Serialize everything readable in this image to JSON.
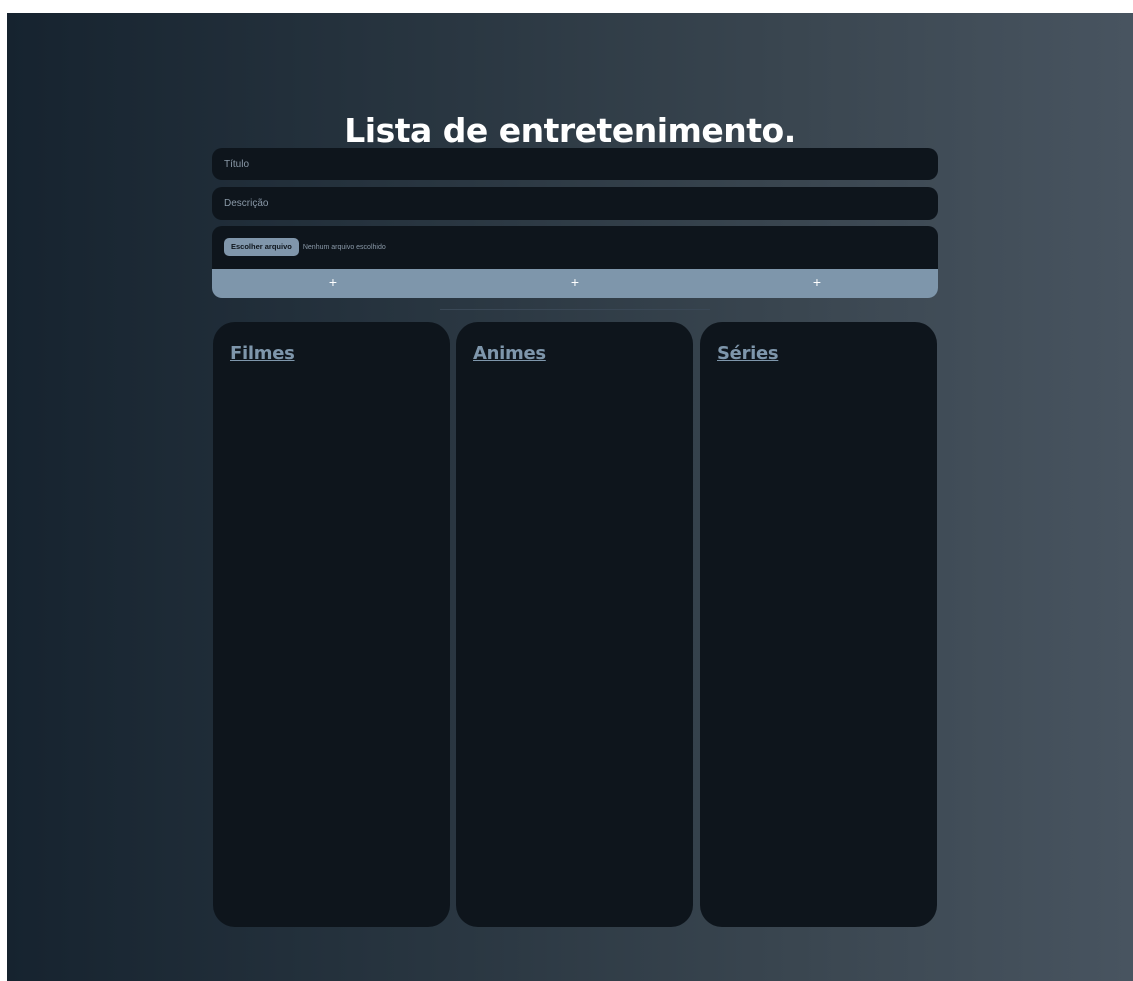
{
  "header": {
    "title": "Lista de entretenimento."
  },
  "form": {
    "title_placeholder": "Título",
    "description_placeholder": "Descrição",
    "file_button_label": "Escolher arquivo",
    "file_status": "Nenhum arquivo escolhido",
    "add_buttons": [
      "+",
      "+",
      "+"
    ]
  },
  "columns": [
    {
      "heading": "Filmes"
    },
    {
      "heading": "Animes"
    },
    {
      "heading": "Séries"
    }
  ],
  "colors": {
    "card_background": "#0e151c",
    "accent": "#7e96ab",
    "title_text": "#ffffff"
  }
}
